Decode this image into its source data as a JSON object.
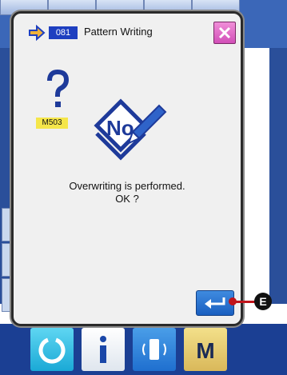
{
  "dialog": {
    "function_code": "081",
    "title": "Pattern Writing",
    "message_code": "M503",
    "message_line1": "Overwriting is performed.",
    "message_line2": "OK ?"
  },
  "callout": {
    "label": "E"
  },
  "icons": {
    "title": "arrow-right-icon",
    "close": "close-icon",
    "question": "question-mark-icon",
    "number": "number-pencil-icon",
    "enter": "enter-icon"
  },
  "colors": {
    "code_badge": "#1e3fc0",
    "close_button": "#d24fb8",
    "message_code_bg": "#f5e64a",
    "enter_button": "#1a5fc0",
    "callout": "#c0141b"
  }
}
